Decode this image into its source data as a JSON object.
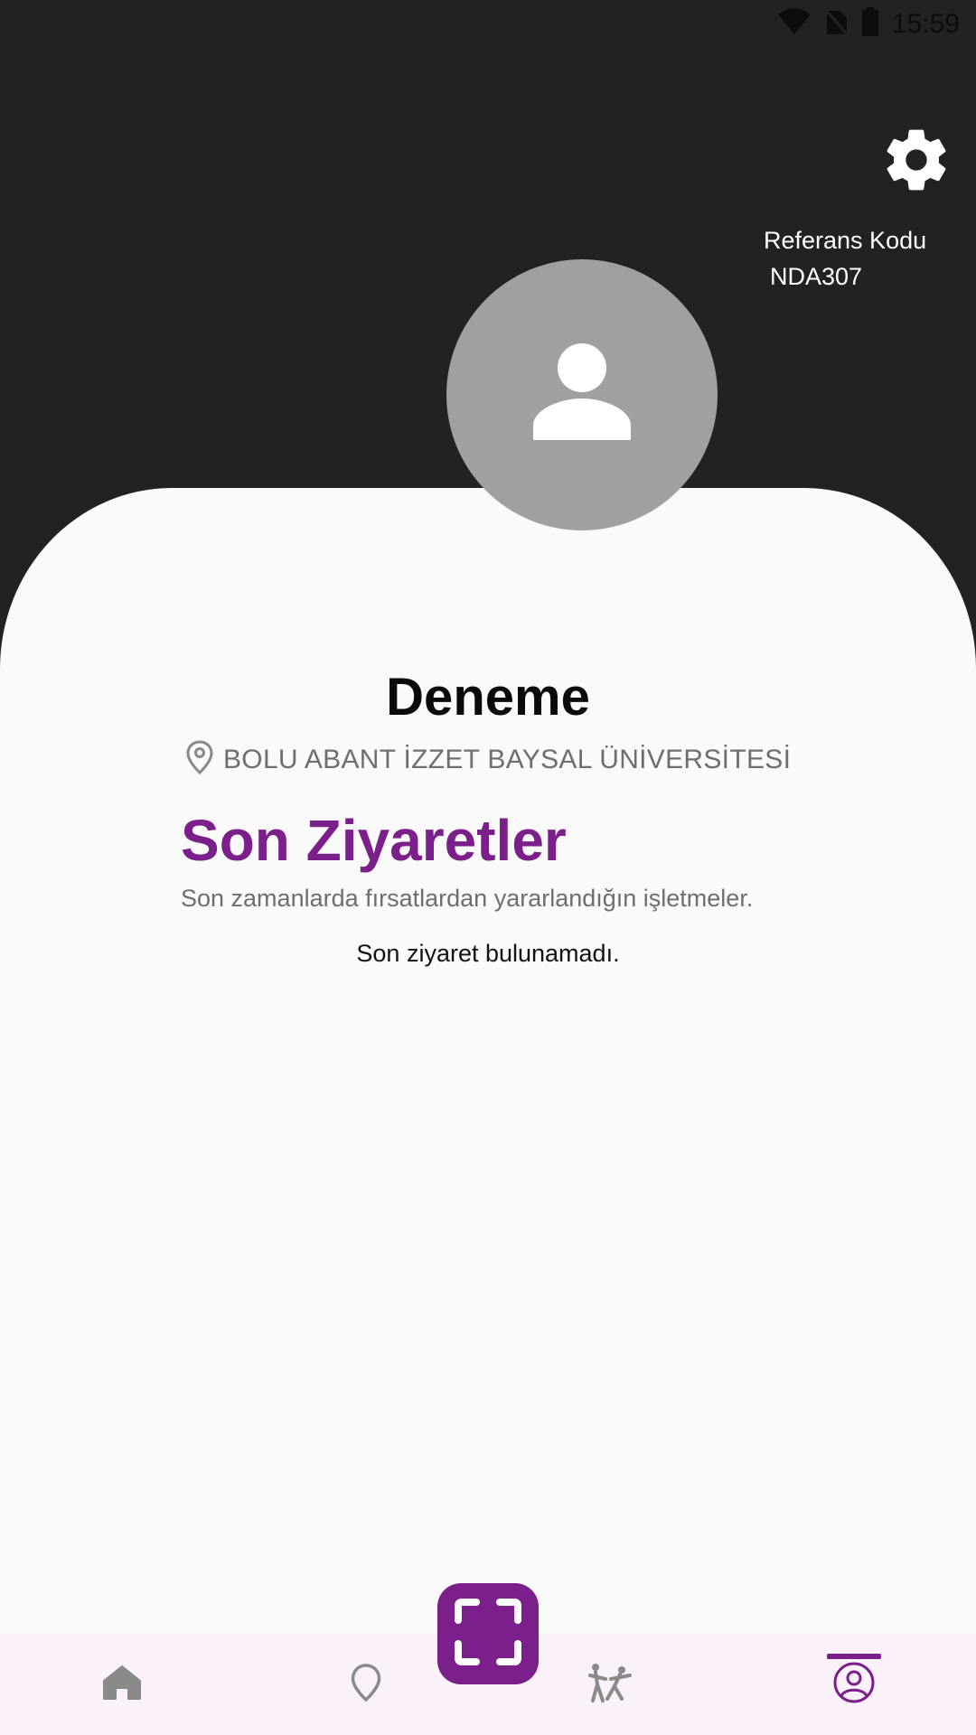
{
  "status_bar": {
    "time": "15:59",
    "icons": [
      "wifi-icon",
      "no-sim-icon",
      "battery-icon"
    ]
  },
  "header": {
    "settings_icon": "gear-icon",
    "referral_label": "Referans Kodu",
    "referral_code": "NDA307"
  },
  "profile": {
    "avatar_icon": "person-icon",
    "name": "Deneme",
    "location_icon": "location-pin-icon",
    "location": "BOLU ABANT İZZET BAYSAL ÜNİVERSİTESİ"
  },
  "recent_visits": {
    "title": "Son Ziyaretler",
    "subtitle": "Son zamanlarda fırsatlardan yararlandığın işletmeler.",
    "empty_message": "Son ziyaret bulunamadı."
  },
  "bottom_nav": {
    "items": [
      {
        "icon": "home-icon",
        "active": false
      },
      {
        "icon": "map-pin-icon",
        "active": false
      },
      {
        "icon": "activity-icon",
        "active": false
      },
      {
        "icon": "profile-icon",
        "active": true
      }
    ],
    "scan_icon": "scan-frame-icon"
  },
  "colors": {
    "header_bg": "#222222",
    "accent": "#7b1f8a",
    "avatar_bg": "#a0a0a0",
    "nav_bg": "#fbf1fb",
    "muted_text": "#6e6e6e"
  }
}
